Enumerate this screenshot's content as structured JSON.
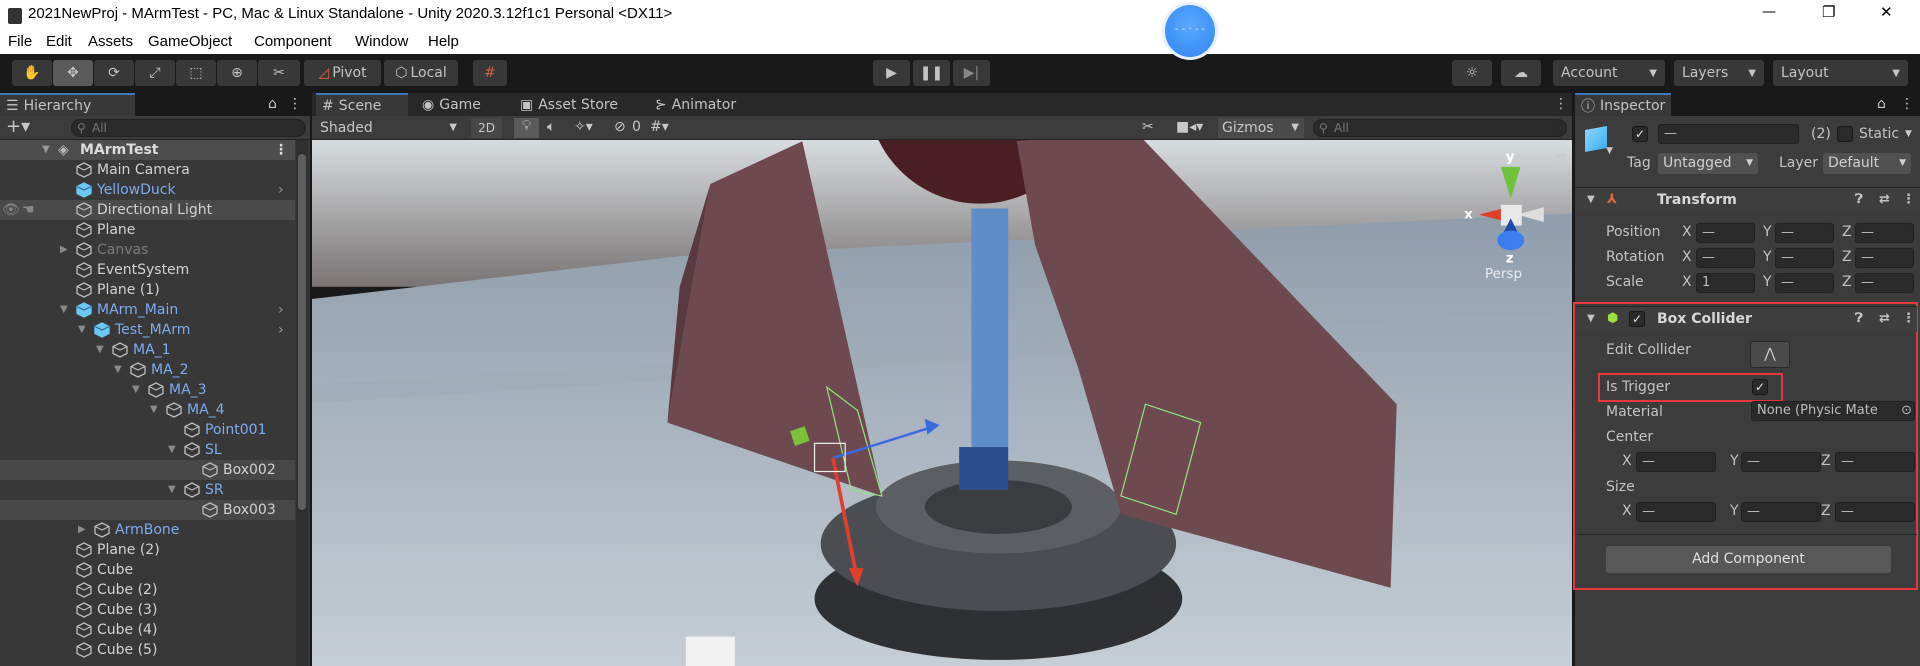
{
  "window": {
    "title": "2021NewProj - MArmTest - PC, Mac & Linux Standalone - Unity 2020.3.12f1c1 Personal <DX11>",
    "minimize": "—",
    "restore": "❐",
    "close": "✕"
  },
  "menu": [
    "File",
    "Edit",
    "Assets",
    "GameObject",
    "Component",
    "Window",
    "Help"
  ],
  "toolbar": {
    "pivot": "Pivot",
    "local": "Local",
    "account": "Account",
    "layers": "Layers",
    "layout": "Layout"
  },
  "tabs": {
    "hierarchy": "Hierarchy",
    "scene": "Scene",
    "game": "Game",
    "asset_store": "Asset Store",
    "animator": "Animator",
    "inspector": "Inspector"
  },
  "hierarchy": {
    "search_placeholder": "All",
    "scene_name": "MArmTest",
    "rows": [
      {
        "label": "Main Camera"
      },
      {
        "label": "YellowDuck"
      },
      {
        "label": "Directional Light"
      },
      {
        "label": "Plane"
      },
      {
        "label": "Canvas"
      },
      {
        "label": "EventSystem"
      },
      {
        "label": "Plane (1)"
      },
      {
        "label": "MArm_Main"
      },
      {
        "label": "Test_MArm"
      },
      {
        "label": "MA_1"
      },
      {
        "label": "MA_2"
      },
      {
        "label": "MA_3"
      },
      {
        "label": "MA_4"
      },
      {
        "label": "Point001"
      },
      {
        "label": "SL"
      },
      {
        "label": "Box002"
      },
      {
        "label": "SR"
      },
      {
        "label": "Box003"
      },
      {
        "label": "ArmBone"
      },
      {
        "label": "Plane (2)"
      },
      {
        "label": "Cube"
      },
      {
        "label": "Cube (2)"
      },
      {
        "label": "Cube (3)"
      },
      {
        "label": "Cube (4)"
      },
      {
        "label": "Cube (5)"
      }
    ]
  },
  "scene": {
    "shading": "Shaded",
    "mode_2d": "2D",
    "hidden_count": "0",
    "gizmos": "Gizmos",
    "search_placeholder": "All",
    "axis_y": "y",
    "axis_x": "x",
    "axis_z": "z",
    "projection": "Persp"
  },
  "inspector": {
    "name_value": "—",
    "count": "(2)",
    "static": "Static",
    "tag_label": "Tag",
    "tag_value": "Untagged",
    "layer_label": "Layer",
    "layer_value": "Default",
    "transform": {
      "title": "Transform",
      "rows": [
        {
          "label": "Position",
          "x": "—",
          "y": "—",
          "z": "—"
        },
        {
          "label": "Rotation",
          "x": "—",
          "y": "—",
          "z": "—"
        },
        {
          "label": "Scale",
          "x": "1",
          "y": "—",
          "z": "—"
        }
      ]
    },
    "box_collider": {
      "title": "Box Collider",
      "edit_collider": "Edit Collider",
      "is_trigger": "Is Trigger",
      "is_trigger_checked": true,
      "material_label": "Material",
      "material_value": "None (Physic Mate",
      "center_label": "Center",
      "center": {
        "x": "—",
        "y": "—",
        "z": "—"
      },
      "size_label": "Size",
      "size": {
        "x": "—",
        "y": "—",
        "z": "—"
      }
    },
    "add_component": "Add Component",
    "axis": {
      "x": "X",
      "y": "Y",
      "z": "Z"
    }
  },
  "colors": {
    "highlight_box": "#e8383a",
    "prefab_blue": "#7bacf0",
    "selection_tab": "#3a79bb"
  }
}
